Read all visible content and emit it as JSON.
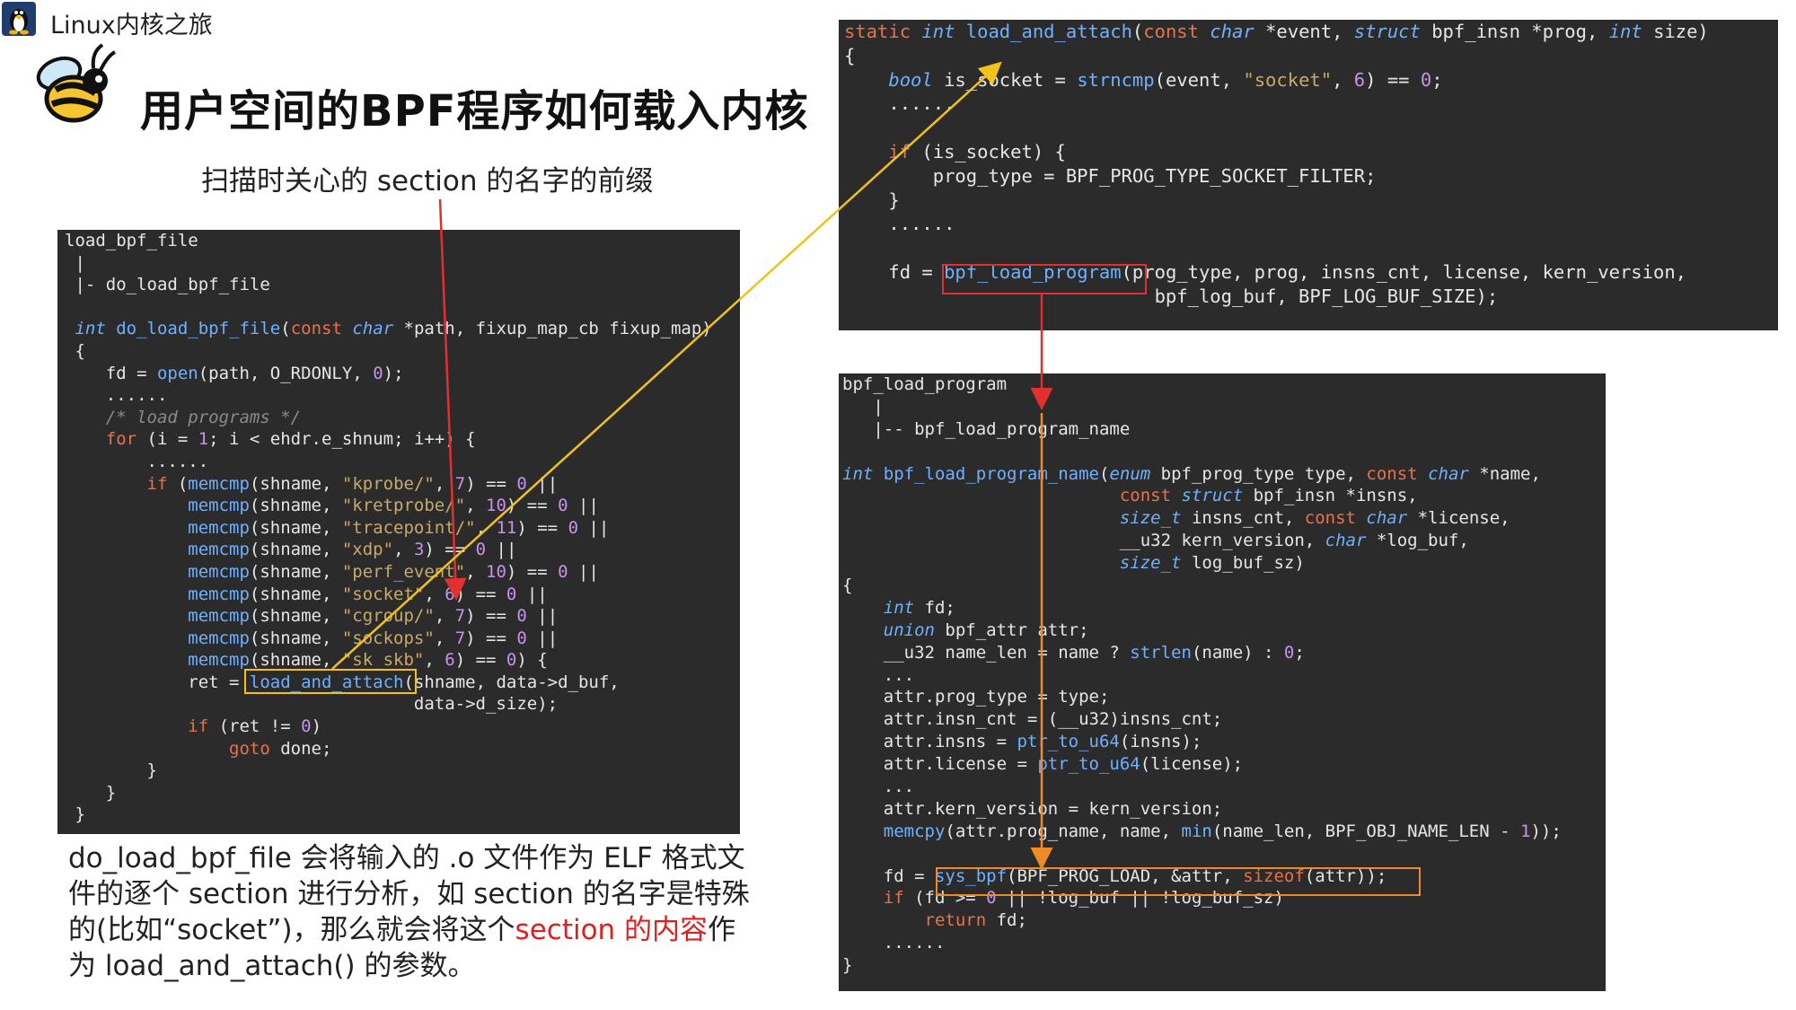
{
  "header": {
    "brand": "Linux内核之旅",
    "title": "用户空间的BPF程序如何载入内核",
    "caption": "扫描时关心的 section 的名字的前缀"
  },
  "colors": {
    "panel_bg": "#2b2b2b",
    "arrow_red": "#e23030",
    "arrow_yellow": "#f2c21b",
    "arrow_orange": "#ee8b28",
    "highlight_text": "#e02020"
  },
  "icons": {
    "logo": "tux-penguin-icon",
    "mascot": "bee-icon"
  },
  "left_code": {
    "lines": [
      [
        [
          "plain",
          "load_bpf_file"
        ]
      ],
      [
        [
          "plain",
          " |"
        ]
      ],
      [
        [
          "plain",
          " |- do_load_bpf_file"
        ]
      ],
      [
        [
          "plain",
          ""
        ]
      ],
      [
        [
          "ty",
          " int "
        ],
        [
          "fn",
          "do_load_bpf_file"
        ],
        [
          "plain",
          "("
        ],
        [
          "kw",
          "const "
        ],
        [
          "ty",
          "char "
        ],
        [
          "plain",
          "*path, fixup_map_cb fixup_map)"
        ]
      ],
      [
        [
          "plain",
          " {"
        ]
      ],
      [
        [
          "plain",
          "    fd = "
        ],
        [
          "fn",
          "open"
        ],
        [
          "plain",
          "(path, O_RDONLY, "
        ],
        [
          "nm",
          "0"
        ],
        [
          "plain",
          ");"
        ]
      ],
      [
        [
          "plain",
          "    ......"
        ]
      ],
      [
        [
          "cm",
          "    /* load programs */"
        ]
      ],
      [
        [
          "kw",
          "    for "
        ],
        [
          "plain",
          "(i = "
        ],
        [
          "nm",
          "1"
        ],
        [
          "plain",
          "; i < ehdr.e_shnum; i++) {"
        ]
      ],
      [
        [
          "plain",
          "        ......"
        ]
      ],
      [
        [
          "kw",
          "        if "
        ],
        [
          "plain",
          "("
        ],
        [
          "fn",
          "memcmp"
        ],
        [
          "plain",
          "(shname, "
        ],
        [
          "st",
          "\"kprobe/\""
        ],
        [
          "plain",
          ", "
        ],
        [
          "nm",
          "7"
        ],
        [
          "plain",
          ") == "
        ],
        [
          "nm",
          "0"
        ],
        [
          "plain",
          " ||"
        ]
      ],
      [
        [
          "fn",
          "            memcmp"
        ],
        [
          "plain",
          "(shname, "
        ],
        [
          "st",
          "\"kretprobe/\""
        ],
        [
          "plain",
          ", "
        ],
        [
          "nm",
          "10"
        ],
        [
          "plain",
          ") == "
        ],
        [
          "nm",
          "0"
        ],
        [
          "plain",
          " ||"
        ]
      ],
      [
        [
          "fn",
          "            memcmp"
        ],
        [
          "plain",
          "(shname, "
        ],
        [
          "st",
          "\"tracepoint/\""
        ],
        [
          "plain",
          ", "
        ],
        [
          "nm",
          "11"
        ],
        [
          "plain",
          ") == "
        ],
        [
          "nm",
          "0"
        ],
        [
          "plain",
          " ||"
        ]
      ],
      [
        [
          "fn",
          "            memcmp"
        ],
        [
          "plain",
          "(shname, "
        ],
        [
          "st",
          "\"xdp\""
        ],
        [
          "plain",
          ", "
        ],
        [
          "nm",
          "3"
        ],
        [
          "plain",
          ") == "
        ],
        [
          "nm",
          "0"
        ],
        [
          "plain",
          " ||"
        ]
      ],
      [
        [
          "fn",
          "            memcmp"
        ],
        [
          "plain",
          "(shname, "
        ],
        [
          "st",
          "\"perf_event\""
        ],
        [
          "plain",
          ", "
        ],
        [
          "nm",
          "10"
        ],
        [
          "plain",
          ") == "
        ],
        [
          "nm",
          "0"
        ],
        [
          "plain",
          " ||"
        ]
      ],
      [
        [
          "fn",
          "            memcmp"
        ],
        [
          "plain",
          "(shname, "
        ],
        [
          "st",
          "\"socket\""
        ],
        [
          "plain",
          ", "
        ],
        [
          "nm",
          "6"
        ],
        [
          "plain",
          ") == "
        ],
        [
          "nm",
          "0"
        ],
        [
          "plain",
          " ||"
        ]
      ],
      [
        [
          "fn",
          "            memcmp"
        ],
        [
          "plain",
          "(shname, "
        ],
        [
          "st",
          "\"cgroup/\""
        ],
        [
          "plain",
          ", "
        ],
        [
          "nm",
          "7"
        ],
        [
          "plain",
          ") == "
        ],
        [
          "nm",
          "0"
        ],
        [
          "plain",
          " ||"
        ]
      ],
      [
        [
          "fn",
          "            memcmp"
        ],
        [
          "plain",
          "(shname, "
        ],
        [
          "st",
          "\"sockops\""
        ],
        [
          "plain",
          ", "
        ],
        [
          "nm",
          "7"
        ],
        [
          "plain",
          ") == "
        ],
        [
          "nm",
          "0"
        ],
        [
          "plain",
          " ||"
        ]
      ],
      [
        [
          "fn",
          "            memcmp"
        ],
        [
          "plain",
          "(shname, "
        ],
        [
          "st",
          "\"sk_skb\""
        ],
        [
          "plain",
          ", "
        ],
        [
          "nm",
          "6"
        ],
        [
          "plain",
          ") == "
        ],
        [
          "nm",
          "0"
        ],
        [
          "plain",
          ") {"
        ]
      ],
      [
        [
          "plain",
          "            ret = "
        ],
        [
          "fn",
          "load_and_attach"
        ],
        [
          "plain",
          "(shname, data->d_buf,"
        ]
      ],
      [
        [
          "plain",
          "                                  data->d_size);"
        ]
      ],
      [
        [
          "kw",
          "            if "
        ],
        [
          "plain",
          "(ret != "
        ],
        [
          "nm",
          "0"
        ],
        [
          "plain",
          ")"
        ]
      ],
      [
        [
          "kw",
          "                goto "
        ],
        [
          "plain",
          "done;"
        ]
      ],
      [
        [
          "plain",
          "        }"
        ]
      ],
      [
        [
          "plain",
          "    }"
        ]
      ],
      [
        [
          "plain",
          " }"
        ]
      ]
    ]
  },
  "top_right_code": {
    "lines": [
      [
        [
          "kw",
          "static "
        ],
        [
          "ty",
          "int "
        ],
        [
          "fn",
          "load_and_attach"
        ],
        [
          "plain",
          "("
        ],
        [
          "kw",
          "const "
        ],
        [
          "ty",
          "char "
        ],
        [
          "plain",
          "*event, "
        ],
        [
          "ty",
          "struct "
        ],
        [
          "plain",
          "bpf_insn *prog, "
        ],
        [
          "ty",
          "int "
        ],
        [
          "plain",
          "size)"
        ]
      ],
      [
        [
          "plain",
          "{"
        ]
      ],
      [
        [
          "ty",
          "    bool "
        ],
        [
          "plain",
          "is_socket = "
        ],
        [
          "fn",
          "strncmp"
        ],
        [
          "plain",
          "(event, "
        ],
        [
          "st",
          "\"socket\""
        ],
        [
          "plain",
          ", "
        ],
        [
          "nm",
          "6"
        ],
        [
          "plain",
          ") == "
        ],
        [
          "nm",
          "0"
        ],
        [
          "plain",
          ";"
        ]
      ],
      [
        [
          "plain",
          "    ......"
        ]
      ],
      [
        [
          "plain",
          ""
        ]
      ],
      [
        [
          "kw",
          "    if "
        ],
        [
          "plain",
          "(is_socket) {"
        ]
      ],
      [
        [
          "plain",
          "        prog_type = BPF_PROG_TYPE_SOCKET_FILTER;"
        ]
      ],
      [
        [
          "plain",
          "    }"
        ]
      ],
      [
        [
          "plain",
          "    ......"
        ]
      ],
      [
        [
          "plain",
          ""
        ]
      ],
      [
        [
          "plain",
          "    fd = "
        ],
        [
          "fn",
          "bpf_load_program"
        ],
        [
          "plain",
          "(prog_type, prog, insns_cnt, license, kern_version,"
        ]
      ],
      [
        [
          "plain",
          "                            bpf_log_buf, BPF_LOG_BUF_SIZE);"
        ]
      ]
    ]
  },
  "bottom_right_code": {
    "lines": [
      [
        [
          "plain",
          "bpf_load_program"
        ]
      ],
      [
        [
          "plain",
          "   |"
        ]
      ],
      [
        [
          "plain",
          "   |-- bpf_load_program_name"
        ]
      ],
      [
        [
          "plain",
          ""
        ]
      ],
      [
        [
          "ty",
          "int "
        ],
        [
          "fn",
          "bpf_load_program_name"
        ],
        [
          "plain",
          "("
        ],
        [
          "ty",
          "enum "
        ],
        [
          "plain",
          "bpf_prog_type type, "
        ],
        [
          "kw",
          "const "
        ],
        [
          "ty",
          "char "
        ],
        [
          "plain",
          "*name,"
        ]
      ],
      [
        [
          "kw",
          "                           const "
        ],
        [
          "ty",
          "struct "
        ],
        [
          "plain",
          "bpf_insn *insns,"
        ]
      ],
      [
        [
          "ty",
          "                           size_t "
        ],
        [
          "plain",
          "insns_cnt, "
        ],
        [
          "kw",
          "const "
        ],
        [
          "ty",
          "char "
        ],
        [
          "plain",
          "*license,"
        ]
      ],
      [
        [
          "plain",
          "                           __u32 kern_version, "
        ],
        [
          "ty",
          "char "
        ],
        [
          "plain",
          "*log_buf,"
        ]
      ],
      [
        [
          "ty",
          "                           size_t "
        ],
        [
          "plain",
          "log_buf_sz)"
        ]
      ],
      [
        [
          "plain",
          "{"
        ]
      ],
      [
        [
          "ty",
          "    int "
        ],
        [
          "plain",
          "fd;"
        ]
      ],
      [
        [
          "ty",
          "    union "
        ],
        [
          "plain",
          "bpf_attr attr;"
        ]
      ],
      [
        [
          "plain",
          "    __u32 name_len = name ? "
        ],
        [
          "fn",
          "strlen"
        ],
        [
          "plain",
          "(name) : "
        ],
        [
          "nm",
          "0"
        ],
        [
          "plain",
          ";"
        ]
      ],
      [
        [
          "plain",
          "    ..."
        ]
      ],
      [
        [
          "plain",
          "    attr.prog_type = type;"
        ]
      ],
      [
        [
          "plain",
          "    attr.insn_cnt = (__u32)insns_cnt;"
        ]
      ],
      [
        [
          "plain",
          "    attr.insns = "
        ],
        [
          "fn",
          "ptr_to_u64"
        ],
        [
          "plain",
          "(insns);"
        ]
      ],
      [
        [
          "plain",
          "    attr.license = "
        ],
        [
          "fn",
          "ptr_to_u64"
        ],
        [
          "plain",
          "(license);"
        ]
      ],
      [
        [
          "plain",
          "    ..."
        ]
      ],
      [
        [
          "plain",
          "    attr.kern_version = kern_version;"
        ]
      ],
      [
        [
          "fn",
          "    memcpy"
        ],
        [
          "plain",
          "(attr.prog_name, name, "
        ],
        [
          "fn",
          "min"
        ],
        [
          "plain",
          "(name_len, BPF_OBJ_NAME_LEN - "
        ],
        [
          "nm",
          "1"
        ],
        [
          "plain",
          "));"
        ]
      ],
      [
        [
          "plain",
          ""
        ]
      ],
      [
        [
          "plain",
          "    fd = "
        ],
        [
          "fn",
          "sys_bpf"
        ],
        [
          "plain",
          "(BPF_PROG_LOAD, &attr, "
        ],
        [
          "kw",
          "sizeof"
        ],
        [
          "plain",
          "(attr));"
        ]
      ],
      [
        [
          "kw",
          "    if "
        ],
        [
          "plain",
          "(fd >= "
        ],
        [
          "nm",
          "0"
        ],
        [
          "plain",
          " || !log_buf || !log_buf_sz)"
        ]
      ],
      [
        [
          "kw",
          "        return "
        ],
        [
          "plain",
          "fd;"
        ]
      ],
      [
        [
          "plain",
          "    ......"
        ]
      ],
      [
        [
          "plain",
          "}"
        ]
      ]
    ]
  },
  "explanation": {
    "part1": "do_load_bpf_file 会将输入的 .o 文件作为 ELF 格式文件的逐个 section 进行分析，如 section 的名字是特殊的(比如“socket”)，那么就会将这个",
    "part2": "section 的内容",
    "part3": "作为 load_and_attach() 的参数。"
  }
}
